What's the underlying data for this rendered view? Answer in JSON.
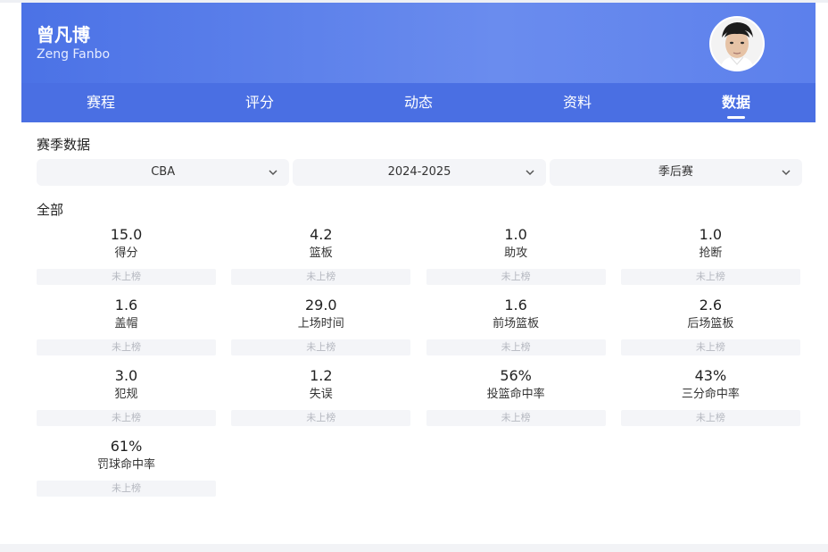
{
  "player": {
    "name_cn": "曾凡博",
    "name_en": "Zeng Fanbo"
  },
  "tabs": [
    {
      "label": "赛程"
    },
    {
      "label": "评分"
    },
    {
      "label": "动态"
    },
    {
      "label": "资料"
    },
    {
      "label": "数据",
      "active": true
    }
  ],
  "section_title": "赛季数据",
  "filters": [
    {
      "value": "CBA"
    },
    {
      "value": "2024-2025"
    },
    {
      "value": "季后赛"
    }
  ],
  "subsection_title": "全部",
  "stats": [
    {
      "value": "15.0",
      "label": "得分",
      "rank": "未上榜"
    },
    {
      "value": "4.2",
      "label": "篮板",
      "rank": "未上榜"
    },
    {
      "value": "1.0",
      "label": "助攻",
      "rank": "未上榜"
    },
    {
      "value": "1.0",
      "label": "抢断",
      "rank": "未上榜"
    },
    {
      "value": "1.6",
      "label": "盖帽",
      "rank": "未上榜"
    },
    {
      "value": "29.0",
      "label": "上场时间",
      "rank": "未上榜"
    },
    {
      "value": "1.6",
      "label": "前场篮板",
      "rank": "未上榜"
    },
    {
      "value": "2.6",
      "label": "后场篮板",
      "rank": "未上榜"
    },
    {
      "value": "3.0",
      "label": "犯规",
      "rank": "未上榜"
    },
    {
      "value": "1.2",
      "label": "失误",
      "rank": "未上榜"
    },
    {
      "value": "56%",
      "label": "投篮命中率",
      "rank": "未上榜"
    },
    {
      "value": "43%",
      "label": "三分命中率",
      "rank": "未上榜"
    },
    {
      "value": "61%",
      "label": "罚球命中率",
      "rank": "未上榜"
    }
  ],
  "colors": {
    "header_blue": "#5c80ec",
    "tab_blue": "#4a6fe3",
    "panel_gray": "#f4f5f8"
  }
}
